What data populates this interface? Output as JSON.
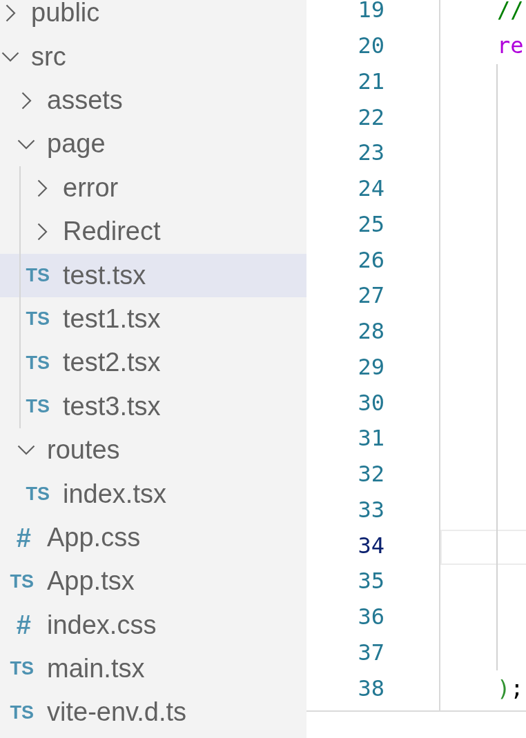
{
  "sidebar": {
    "tree": [
      {
        "kind": "folder",
        "label": "public",
        "expanded": false,
        "selected": false
      },
      {
        "kind": "folder",
        "label": "src",
        "expanded": true,
        "selected": false,
        "children": [
          {
            "kind": "folder",
            "label": "assets",
            "expanded": false,
            "selected": false
          },
          {
            "kind": "folder",
            "label": "page",
            "expanded": true,
            "selected": false,
            "children": [
              {
                "kind": "folder",
                "label": "error",
                "expanded": false,
                "selected": false
              },
              {
                "kind": "folder",
                "label": "Redirect",
                "expanded": false,
                "selected": false
              },
              {
                "kind": "script",
                "icon": "TS",
                "label": "test.tsx",
                "selected": true
              },
              {
                "kind": "script",
                "icon": "TS",
                "label": "test1.tsx",
                "selected": false
              },
              {
                "kind": "script",
                "icon": "TS",
                "label": "test2.tsx",
                "selected": false
              },
              {
                "kind": "script",
                "icon": "TS",
                "label": "test3.tsx",
                "selected": false
              }
            ]
          },
          {
            "kind": "folder",
            "label": "routes",
            "expanded": true,
            "selected": false,
            "children": [
              {
                "kind": "script",
                "icon": "TS",
                "label": "index.tsx",
                "selected": false
              }
            ]
          },
          {
            "kind": "stylesheet",
            "icon": "#",
            "label": "App.css",
            "selected": false
          },
          {
            "kind": "script",
            "icon": "TS",
            "label": "App.tsx",
            "selected": false
          },
          {
            "kind": "stylesheet",
            "icon": "#",
            "label": "index.css",
            "selected": false
          },
          {
            "kind": "script",
            "icon": "TS",
            "label": "main.tsx",
            "selected": false
          },
          {
            "kind": "script",
            "icon": "TS",
            "label": "vite-env.d.ts",
            "selected": false
          }
        ]
      }
    ]
  },
  "editor": {
    "lines": [
      {
        "number": "19",
        "current": false,
        "tokens": [
          {
            "kind": "comment",
            "text": "//"
          }
        ]
      },
      {
        "number": "20",
        "current": false,
        "tokens": [
          {
            "kind": "keyword",
            "text": "re"
          }
        ]
      },
      {
        "number": "21",
        "current": false
      },
      {
        "number": "22",
        "current": false
      },
      {
        "number": "23",
        "current": false
      },
      {
        "number": "24",
        "current": false
      },
      {
        "number": "25",
        "current": false
      },
      {
        "number": "26",
        "current": false
      },
      {
        "number": "27",
        "current": false
      },
      {
        "number": "28",
        "current": false
      },
      {
        "number": "29",
        "current": false
      },
      {
        "number": "30",
        "current": false
      },
      {
        "number": "31",
        "current": false
      },
      {
        "number": "32",
        "current": false
      },
      {
        "number": "33",
        "current": false
      },
      {
        "number": "34",
        "current": true
      },
      {
        "number": "35",
        "current": false
      },
      {
        "number": "36",
        "current": false
      },
      {
        "number": "37",
        "current": false
      },
      {
        "number": "38",
        "current": false,
        "tokens": [
          {
            "kind": "bracket",
            "text": ")"
          },
          {
            "kind": "punctuation",
            "text": ";"
          }
        ]
      }
    ]
  }
}
